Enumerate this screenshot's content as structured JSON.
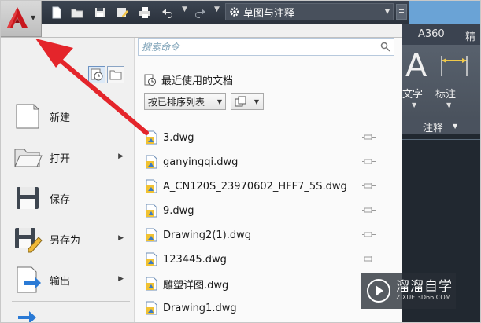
{
  "quick_access": {
    "workspace": "草图与注释",
    "icons": [
      "new-icon",
      "open-icon",
      "save-icon",
      "save-as-icon",
      "print-icon",
      "undo-icon",
      "redo-icon",
      "gear-icon"
    ]
  },
  "ribbon": {
    "tabs": [
      "A360",
      "精"
    ],
    "text_label": "文字",
    "dimension_label": "标注",
    "panel_label": "注释",
    "big_letter": "A"
  },
  "app_menu": {
    "search_placeholder": "搜索命令",
    "recent_title": "最近使用的文档",
    "sort_label": "按已排序列表",
    "commands": [
      {
        "label": "新建",
        "icon": "new-document-icon",
        "submenu": false
      },
      {
        "label": "打开",
        "icon": "open-folder-icon",
        "submenu": true
      },
      {
        "label": "保存",
        "icon": "save-disk-icon",
        "submenu": false
      },
      {
        "label": "另存为",
        "icon": "save-as-pencil-icon",
        "submenu": true
      },
      {
        "label": "输出",
        "icon": "export-arrow-icon",
        "submenu": true
      }
    ],
    "recent_files": [
      "3.dwg",
      "ganyingqi.dwg",
      "A_CN120S_23970602_HFF7_5S.dwg",
      "9.dwg",
      "Drawing2(1).dwg",
      "123445.dwg",
      "雕塑详图.dwg",
      "Drawing1.dwg"
    ]
  },
  "watermark": {
    "title": "溜溜自学",
    "subtitle": "ZIXUE.3D66.COM"
  },
  "colors": {
    "arrow": "#e4252b",
    "autocad_logo": "#c8171d",
    "title_bar": "#2f3640",
    "title_strip": "#6aa3d6"
  }
}
